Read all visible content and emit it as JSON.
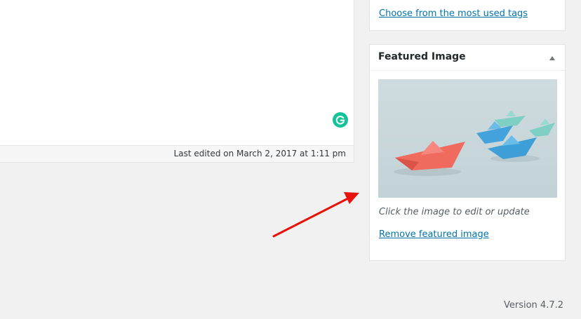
{
  "editor": {
    "last_edited": "Last edited on March 2, 2017 at 1:11 pm",
    "grammarly_icon": "grammarly-g-icon"
  },
  "tags": {
    "most_used_link": "Choose from the most used tags"
  },
  "featured_image": {
    "title": "Featured Image",
    "toggle_icon": "triangle-up-icon",
    "hint": "Click the image to edit or update",
    "remove_link": "Remove featured image"
  },
  "footer": {
    "version": "Version 4.7.2"
  },
  "annotation": {
    "icon": "red-arrow-icon",
    "color": "#e8120c"
  },
  "colors": {
    "link": "#0073aa",
    "grammarly": "#15c39a"
  }
}
